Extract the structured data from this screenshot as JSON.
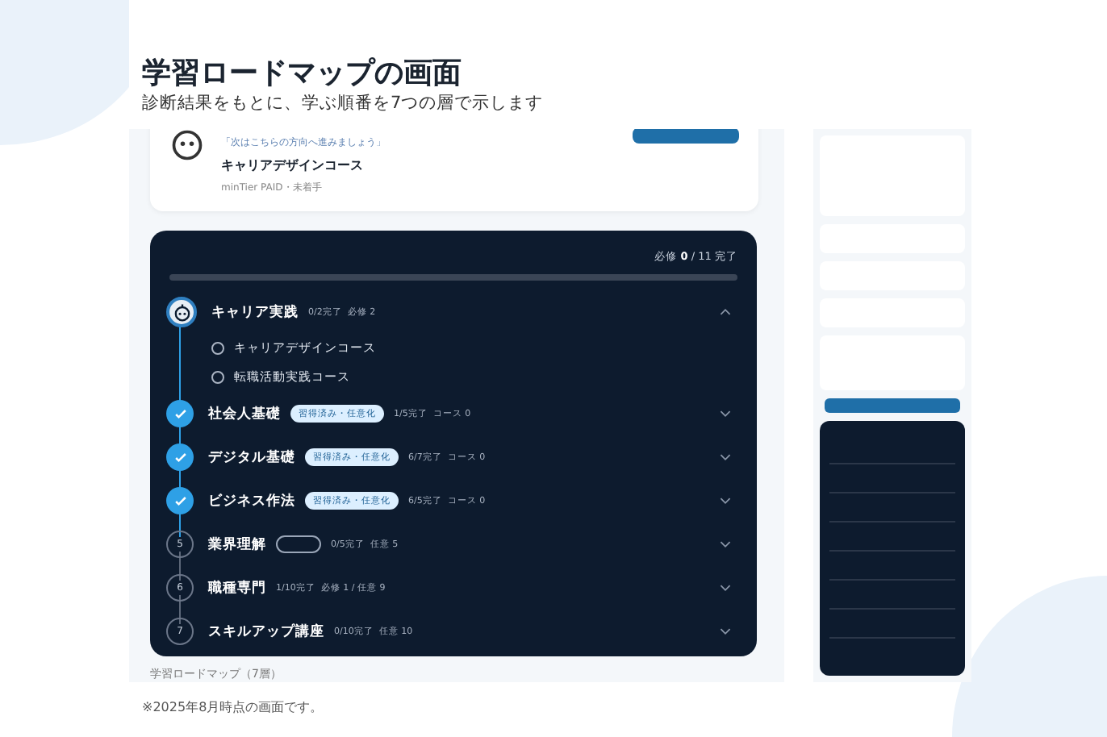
{
  "header": {
    "title": "学習ロードマップの画面",
    "subtitle": "診断結果をもとに、学ぶ順番を7つの層で示します"
  },
  "next_card": {
    "hint": "「次はこちらの方向へ進みましょう」",
    "course": "キャリアデザインコース",
    "meta": "minTier PAID・未着手"
  },
  "roadmap": {
    "progress_prefix": "必修 ",
    "progress_done": "0",
    "progress_suffix": " / 11 完了",
    "level": 0,
    "steps": [
      {
        "kind": "current",
        "title": "キャリア実践",
        "stats": "0/2完了  必修 2",
        "expanded": true,
        "courses": [
          "キャリアデザインコース",
          "転職活動実践コース"
        ]
      },
      {
        "kind": "done",
        "title": "社会人基礎",
        "badge": "習得済み・任意化",
        "stats": "1/5完了  コース 0",
        "expanded": false
      },
      {
        "kind": "done",
        "title": "デジタル基礎",
        "badge": "習得済み・任意化",
        "stats": "6/7完了  コース 0",
        "expanded": false
      },
      {
        "kind": "done",
        "title": "ビジネス作法",
        "badge": "習得済み・任意化",
        "stats": "6/5完了  コース 0",
        "expanded": false
      },
      {
        "kind": "locked",
        "number": "5",
        "title": "業界理解",
        "badge_outline": true,
        "stats": "0/5完了  任意 5",
        "expanded": false
      },
      {
        "kind": "locked",
        "number": "6",
        "title": "職種専門",
        "stats": "1/10完了  必修 1 / 任意 9",
        "expanded": false
      },
      {
        "kind": "locked",
        "number": "7",
        "title": "スキルアップ講座",
        "stats": "0/10完了  任意 10",
        "expanded": false
      }
    ]
  },
  "caption": "学習ロードマップ（7層）",
  "footnote": "※2025年8月時点の画面です。"
}
